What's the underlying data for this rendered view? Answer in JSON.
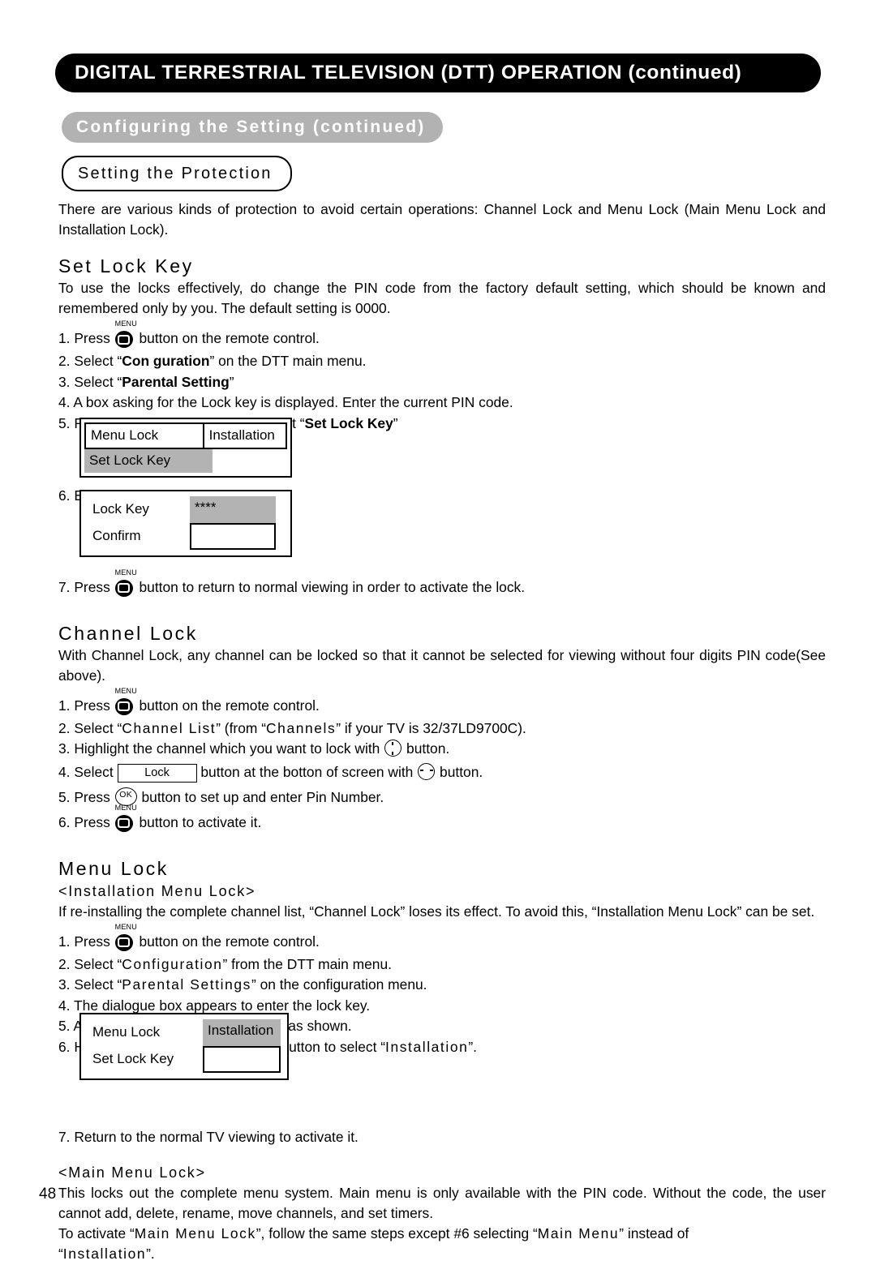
{
  "header": {
    "title": "DIGITAL TERRESTRIAL TELEVISION (DTT) OPERATION (continued)",
    "section": "Configuring the Setting (continued)",
    "subsection": "Setting the Protection"
  },
  "intro": {
    "paragraph": "There are various kinds of protection to avoid certain operations: Channel Lock and Menu Lock (Main Menu Lock and Installation Lock)."
  },
  "set_lock_key": {
    "heading": "Set Lock Key",
    "intro": "To use the locks effectively, do change the PIN code from the factory default setting, which should be known and remembered only by you. The default setting is 0000.",
    "step1_pre": "1. Press",
    "step1_post": "button on the remote control.",
    "step2_pre": "2. Select “",
    "step2_bold": "Con  guration",
    "step2_post": "” on the DTT main menu.",
    "step3_pre": "3. Select “",
    "step3_bold": "Parental Setting",
    "step3_post": "”",
    "step4": "4. A box asking for the Lock key is displayed. Enter the current PIN code.",
    "step5_pre": "5. From the next box appeared, select “",
    "step5_bold": "Set Lock Key",
    "step5_post": "”",
    "step6": "6. Enter new password twice.",
    "step7_pre": "7. Press",
    "step7_post": "button to return to normal viewing in order to activate the lock."
  },
  "dialog_set_lock_key": {
    "menu_lock_label": "Menu Lock",
    "installation_value": "Installation",
    "set_lock_key_label": "Set Lock Key",
    "empty_value": ""
  },
  "dialog_lock_key": {
    "lock_key_label": "Lock Key",
    "lock_key_value": "****",
    "confirm_label": "Confirm",
    "confirm_value": ""
  },
  "channel_lock": {
    "heading": "Channel Lock",
    "intro": "With Channel Lock, any channel can be locked so that it cannot be selected for viewing without four digits PIN code(See above).",
    "step1_pre": "1. Press",
    "step1_post": "button on the remote control.",
    "step2_pre": "2. Select “",
    "step2_spaced1": "Channel List",
    "step2_mid": "” (from “",
    "step2_spaced2": "Channels",
    "step2_post": "” if your TV is 32/37LD9700C).",
    "step3_pre": "3. Highlight the channel which you want to lock with",
    "step3_post": "button.",
    "step4_pre": "4. Select",
    "step4_button": "Lock",
    "step4_mid": "button at the botton of screen with",
    "step4_post": "button.",
    "step5_pre": "5. Press",
    "step5_post": "button to set up and enter Pin Number.",
    "step6_pre": "6. Press",
    "step6_post": "button to activate it."
  },
  "menu_lock": {
    "heading": "Menu Lock",
    "installation_subheading": "<Installation Menu Lock>",
    "intro": "If re-installing the complete channel list, “Channel Lock” loses its effect. To avoid this, “Installation Menu Lock” can be set.",
    "step1_pre": "1. Press",
    "step1_post": "button on the remote control.",
    "step2_pre": "2. Select “",
    "step2_spaced": "Configuration",
    "step2_post": "” from the DTT main menu.",
    "step3_pre": "3. Select “",
    "step3_spaced": "Parental Settings",
    "step3_post": "” on the configuration menu.",
    "step4": "4. The dialogue box appears to enter the lock key.",
    "step5": "5. Another dialogue box is displayed as shown.",
    "step6_pre": "6. Highlight “",
    "step6_spaced1": "Menu Lock",
    "step6_mid": "” and use button to select “",
    "step6_spaced2": "Installation",
    "step6_post": "”.",
    "step7": "7. Return to the normal TV viewing to activate it.",
    "main_subheading": "<Main Menu Lock>",
    "main_para1": "This locks out the complete menu system. Main menu is only available with the PIN code. Without the code, the user cannot add, delete, rename, move channels, and set timers.",
    "main_para2_pre": "To activate “",
    "main_para2_spaced1": "Main Menu Lock",
    "main_para2_mid": "”, follow the same steps except #6 selecting “",
    "main_para2_spaced2": "Main Menu",
    "main_para2_post": "” instead of",
    "main_para3_pre": "“",
    "main_para3_spaced": "Installation",
    "main_para3_post": "”."
  },
  "dialog_menu_lock": {
    "menu_lock_label": "Menu Lock",
    "installation_value": "Installation",
    "set_lock_key_label": "Set Lock Key",
    "empty_value": ""
  },
  "icons": {
    "menu_label": "MENU",
    "ok_label": "OK"
  },
  "footer": {
    "page_number": "48"
  },
  "colors": {
    "banner_black": "#000000",
    "banner_gray": "#b2b2b2",
    "highlight_gray": "#b3b3b3"
  }
}
